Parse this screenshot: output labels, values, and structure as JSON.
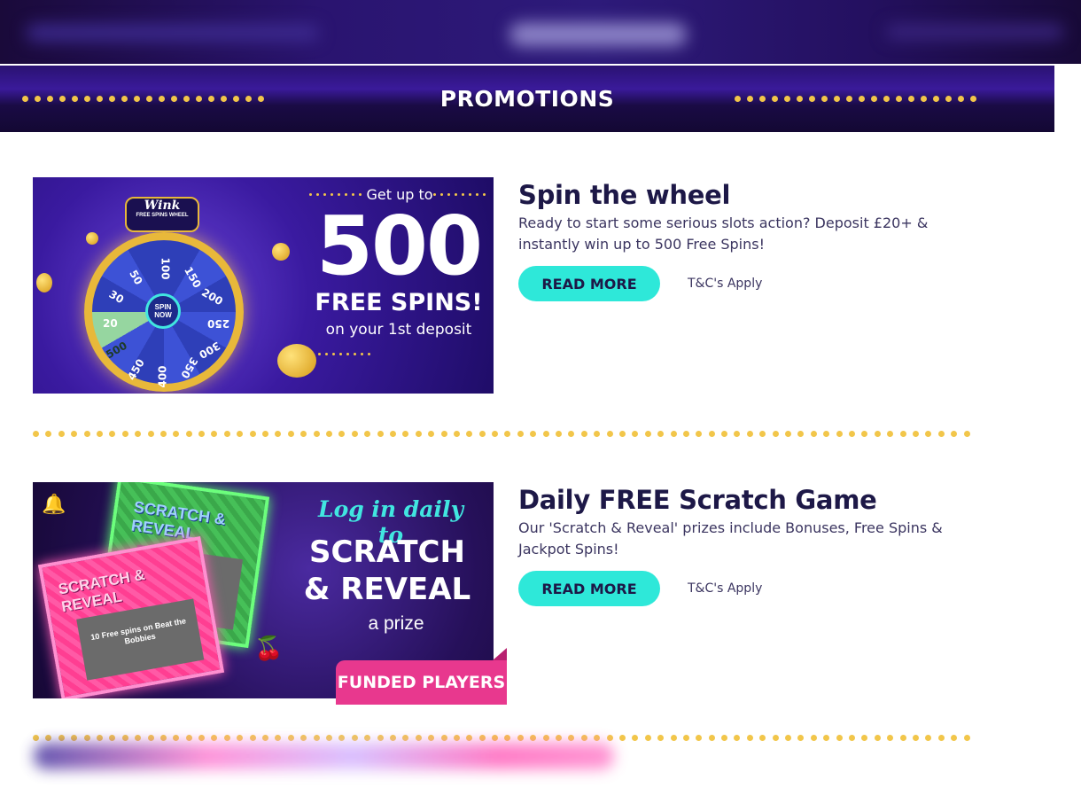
{
  "header": {
    "title": "PROMOTIONS"
  },
  "promotions": [
    {
      "title": "Spin the wheel",
      "description": "Ready to start some serious slots action? Deposit £20+ & instantly win up to 500 Free Spins!",
      "read_more_label": "READ MORE",
      "terms_label": "T&C's Apply",
      "banner": {
        "badge_title": "Wink",
        "badge_subtitle": "FREE SPINS WHEEL",
        "tagline": "Get up to",
        "amount": "500",
        "offer": "FREE SPINS!",
        "deposit_note": "on your 1st deposit",
        "hub_label": "SPIN NOW",
        "wheel_values": [
          "100",
          "150",
          "200",
          "250",
          "300",
          "350",
          "400",
          "450",
          "500",
          "20",
          "30",
          "50"
        ]
      }
    },
    {
      "title": "Daily FREE Scratch Game",
      "description": "Our 'Scratch & Reveal' prizes include Bonuses, Free Spins & Jackpot Spins!",
      "read_more_label": "READ MORE",
      "terms_label": "T&C's Apply",
      "banner": {
        "tagline": "Log in daily to",
        "headline_line1": "SCRATCH",
        "headline_line2": "& REVEAL",
        "subline": "a prize",
        "card_label": "SCRATCH & REVEAL",
        "card_prize": "10 Free spins on Beat the Bobbies",
        "ribbon": "FUNDED PLAYERS"
      }
    }
  ],
  "colors": {
    "accent_cta": "#2ee8d9",
    "dots": "#f2c64a",
    "ribbon": "#e8388e",
    "heading": "#1d1847"
  }
}
